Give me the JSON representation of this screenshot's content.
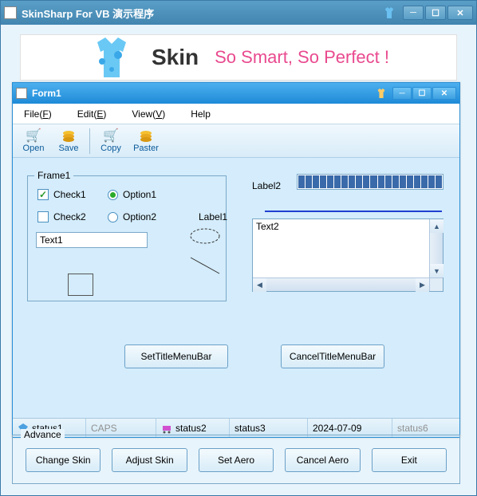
{
  "outer": {
    "title": "SkinSharp For VB 演示程序"
  },
  "banner": {
    "brand": "Skin",
    "slogan": "So Smart, So Perfect !"
  },
  "form": {
    "title": "Form1",
    "menu": {
      "file": "File(F)",
      "edit": "Edit(E)",
      "view": "View(V)",
      "help": "Help"
    },
    "toolbar": {
      "open": "Open",
      "save": "Save",
      "copy": "Copy",
      "paster": "Paster"
    },
    "frame1": {
      "legend": "Frame1",
      "check1": "Check1",
      "check1_checked": true,
      "check2": "Check2",
      "check2_checked": false,
      "option1": "Option1",
      "option1_checked": true,
      "option2": "Option2",
      "option2_checked": false,
      "text1": "Text1"
    },
    "label1": "Label1",
    "label2": "Label2",
    "text2": "Text2",
    "buttons": {
      "set_title": "SetTitleMenuBar",
      "cancel_title": "CancelTitleMenuBar"
    },
    "status": {
      "s1": "status1",
      "caps": "CAPS",
      "s2": "status2",
      "s3": "status3",
      "date": "2024-07-09",
      "s6": "status6"
    }
  },
  "advance": {
    "legend": "Advance",
    "change_skin": "Change Skin",
    "adjust_skin": "Adjust Skin",
    "set_aero": "Set Aero",
    "cancel_aero": "Cancel Aero",
    "exit": "Exit"
  }
}
